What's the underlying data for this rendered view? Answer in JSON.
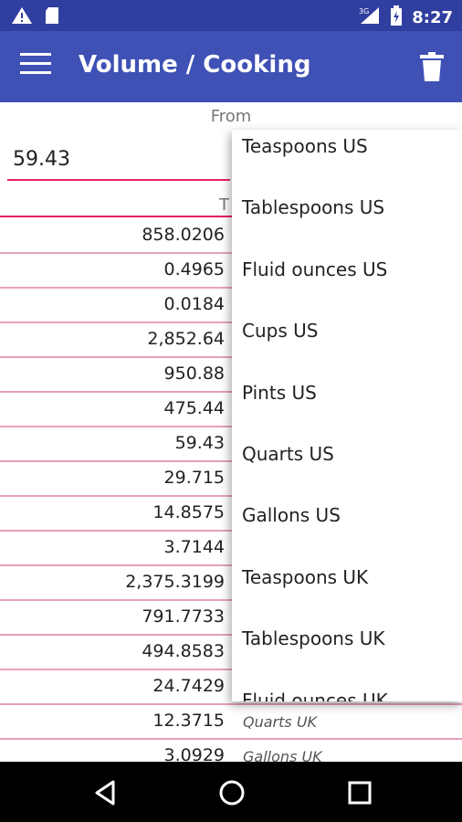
{
  "status": {
    "time": "8:27",
    "network": "3G"
  },
  "toolbar": {
    "title": "Volume / Cooking"
  },
  "converter": {
    "from_label": "From",
    "to_label": "T",
    "input_value": "59.43"
  },
  "results": [
    {
      "value": "858.0206",
      "unit": ""
    },
    {
      "value": "0.4965",
      "unit": ""
    },
    {
      "value": "0.0184",
      "unit": ""
    },
    {
      "value": "2,852.64",
      "unit": ""
    },
    {
      "value": "950.88",
      "unit": ""
    },
    {
      "value": "475.44",
      "unit": ""
    },
    {
      "value": "59.43",
      "unit": ""
    },
    {
      "value": "29.715",
      "unit": ""
    },
    {
      "value": "14.8575",
      "unit": ""
    },
    {
      "value": "3.7144",
      "unit": ""
    },
    {
      "value": "2,375.3199",
      "unit": ""
    },
    {
      "value": "791.7733",
      "unit": ""
    },
    {
      "value": "494.8583",
      "unit": ""
    },
    {
      "value": "24.7429",
      "unit": ""
    },
    {
      "value": "12.3715",
      "unit": "Quarts UK"
    },
    {
      "value": "3.0929",
      "unit": "Gallons UK"
    }
  ],
  "dropdown": {
    "items": [
      "Teaspoons US",
      "Tablespoons US",
      "Fluid ounces US",
      "Cups US",
      "Pints US",
      "Quarts US",
      "Gallons US",
      "Teaspoons UK",
      "Tablespoons UK",
      "Fluid ounces UK"
    ]
  },
  "colors": {
    "primary": "#3F51B5",
    "primary_dark": "#303F9F",
    "accent": "#E91E63"
  },
  "icons": [
    "warning-icon",
    "sd-card-icon",
    "signal-3g-icon",
    "battery-icon",
    "menu-icon",
    "delete-icon",
    "back-icon",
    "home-icon",
    "recents-icon"
  ]
}
